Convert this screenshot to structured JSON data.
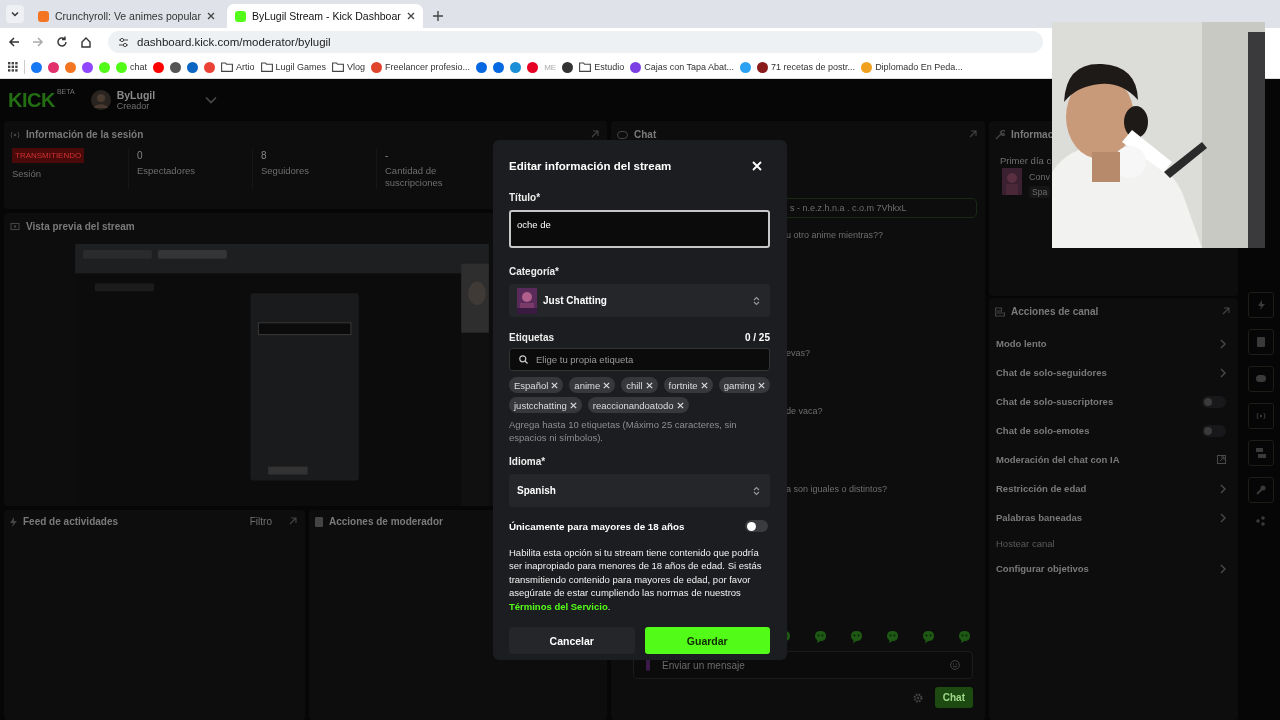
{
  "browser": {
    "tabs": [
      {
        "title": "Crunchyroll: Ve animes popular",
        "selected": false,
        "color": "#f47521"
      },
      {
        "title": "ByLugil Stream - Kick Dashboar",
        "selected": true,
        "color": "#53fc18"
      }
    ],
    "url": "dashboard.kick.com/moderator/bylugil",
    "bookmarks": [
      {
        "kind": "site",
        "color": "#1877f2"
      },
      {
        "kind": "site",
        "color": "#e1306c"
      },
      {
        "kind": "site",
        "color": "#f47521"
      },
      {
        "kind": "site",
        "color": "#9146ff"
      },
      {
        "kind": "site",
        "color": "#53fc18"
      },
      {
        "kind": "site",
        "color": "#53fc18",
        "label": "chat"
      },
      {
        "kind": "site",
        "color": "#ff0000"
      },
      {
        "kind": "site",
        "color": "#555555"
      },
      {
        "kind": "site",
        "color": "#0a66c2"
      },
      {
        "kind": "site",
        "color": "#ea4335"
      },
      {
        "kind": "folder",
        "label": "Artio"
      },
      {
        "kind": "folder",
        "label": "Lugil Games"
      },
      {
        "kind": "folder",
        "label": "Vlog"
      },
      {
        "kind": "site",
        "color": "#e0442c",
        "label": "Freelancer profesio..."
      },
      {
        "kind": "site",
        "color": "#0668e1"
      },
      {
        "kind": "site",
        "color": "#0668e1"
      },
      {
        "kind": "site",
        "color": "#1a8fd8"
      },
      {
        "kind": "site",
        "color": "#e60023"
      },
      {
        "kind": "text",
        "label": "ME"
      },
      {
        "kind": "site",
        "color": "#333333"
      },
      {
        "kind": "folder",
        "label": "Estudio"
      },
      {
        "kind": "site",
        "color": "#7b3fe4",
        "label": "Cajas con Tapa Abat..."
      },
      {
        "kind": "site",
        "color": "#2aa1f2"
      },
      {
        "kind": "site",
        "color": "#8b1a1a",
        "label": "71 recetas de postr..."
      },
      {
        "kind": "site",
        "color": "#f0a020",
        "label": "Diplomado En Peda..."
      }
    ]
  },
  "header": {
    "logo": "KICK",
    "logo_badge": "BETA",
    "user": "ByLugil",
    "role": "Creador"
  },
  "session": {
    "title": "Información de la sesión",
    "stats": [
      {
        "kind": "badge",
        "value": "TRANSMITIENDO",
        "label": "Sesión"
      },
      {
        "kind": "number",
        "value": "0",
        "label": "Espectadores"
      },
      {
        "kind": "number",
        "value": "8",
        "label": "Seguidores"
      },
      {
        "kind": "number",
        "value": "-",
        "label": "Cantidad de suscripciones"
      }
    ]
  },
  "preview": {
    "title": "Vista previa del stream"
  },
  "activity_feed": {
    "title": "Feed de actividades",
    "filter": "Filtro"
  },
  "moderator_actions": {
    "title": "Acciones de moderador"
  },
  "chat": {
    "title": "Chat",
    "pinned": "s - n.e.z.h.n.a . c.o.m 7VhkxL",
    "messages": [
      "u otro anime mientras??",
      "evas?",
      "de vaca?",
      "a son iguales o distintos?"
    ],
    "input_placeholder": "Enviar un mensaje",
    "send": "Chat"
  },
  "info_panel": {
    "title": "Informac",
    "item_title": "Primer día c",
    "item_line": "Conv",
    "item_tag": "Spa"
  },
  "channel_actions": {
    "title": "Acciones de canal",
    "items": [
      {
        "kind": "submenu",
        "label": "Modo lento"
      },
      {
        "kind": "submenu",
        "label": "Chat de solo-seguidores"
      },
      {
        "kind": "toggle",
        "label": "Chat de solo-suscriptores",
        "on": false
      },
      {
        "kind": "toggle",
        "label": "Chat de solo-emotes",
        "on": false
      },
      {
        "kind": "external",
        "label": "Moderación del chat con IA"
      },
      {
        "kind": "submenu",
        "label": "Restricción de edad"
      },
      {
        "kind": "submenu",
        "label": "Palabras baneadas"
      },
      {
        "kind": "disabled",
        "label": "Hostear canal"
      },
      {
        "kind": "submenu",
        "label": "Configurar objetivos"
      }
    ]
  },
  "modal": {
    "title": "Editar información del stream",
    "title_label": "Título*",
    "title_value": "oche de",
    "category_label": "Categoría*",
    "category": "Just Chatting",
    "tags_label": "Etiquetas",
    "tags_count": "0 / 25",
    "tags_placeholder": "Elige tu propia etiqueta",
    "tags": [
      "Español",
      "anime",
      "chill",
      "fortnite",
      "gaming",
      "justcchatting",
      "reaccionandoatodo"
    ],
    "tags_hint": "Agrega hasta 10 etiquetas (Máximo 25 caracteres, sin espacios ni símbolos).",
    "language_label": "Idioma*",
    "language": "Spanish",
    "mature_label": "Únicamente para mayores de 18 años",
    "mature_on": false,
    "description": "Habilita esta opción si tu stream tiene contenido que podría ser inapropiado para menores de 18 años de edad. Si estás transmitiendo contenido para mayores de edad, por favor asegúrate de estar cumpliendo las normas de nuestros ",
    "terms_link": "Términos del Servicio",
    "description_end": ".",
    "cancel": "Cancelar",
    "save": "Guardar"
  }
}
